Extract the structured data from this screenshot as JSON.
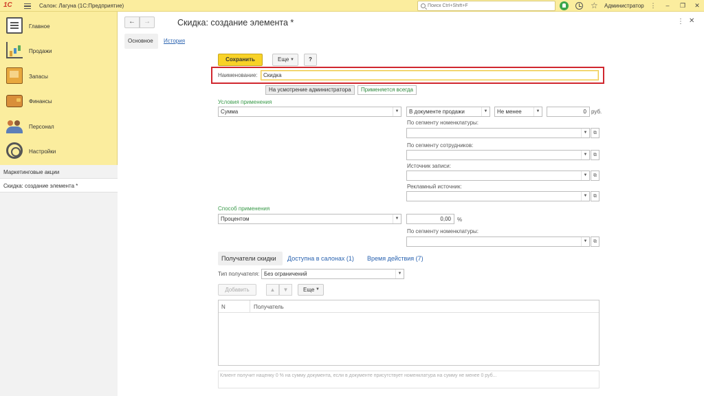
{
  "topbar": {
    "logo": "1С",
    "title": "Салон: Лагуна  (1С:Предприятие)",
    "search_placeholder": "Поиск Ctrl+Shift+F",
    "user": "Администратор"
  },
  "sidebar": {
    "items": [
      {
        "label": "Главное",
        "icon": "clipboard-icon"
      },
      {
        "label": "Продажи",
        "icon": "sales-chart-icon"
      },
      {
        "label": "Запасы",
        "icon": "stock-icon"
      },
      {
        "label": "Финансы",
        "icon": "wallet-icon"
      },
      {
        "label": "Персонал",
        "icon": "people-icon"
      },
      {
        "label": "Настройки",
        "icon": "gear-icon"
      }
    ],
    "panel_header": "Маркетинговые акции",
    "open_window": "Скидка: создание элемента *"
  },
  "form": {
    "title": "Скидка: создание элемента *",
    "tabs": {
      "main": "Основное",
      "history": "История"
    },
    "toolbar": {
      "save": "Сохранить",
      "more": "Еще",
      "help": "?"
    },
    "name_label": "Наименование:",
    "name_value": "Скидка",
    "mode_buttons": {
      "admin": "На усмотрение администратора",
      "always": "Применяется всегда"
    },
    "conditions": {
      "title": "Условия применения",
      "type_value": "Сумма",
      "doc_value": "В документе продажи",
      "compare_value": "Не менее",
      "amount_value": "0",
      "currency": "руб.",
      "segment_nom_label": "По сегменту номенклатуры:",
      "segment_staff_label": "По сегменту сотрудников:",
      "source_label": "Источник записи:",
      "ad_source_label": "Рекламный источник:"
    },
    "method": {
      "title": "Способ применения",
      "type_value": "Процентом",
      "value": "0,00",
      "unit": "%",
      "segment_nom_label": "По сегменту номенклатуры:"
    },
    "bottom_tabs": {
      "recipients": "Получатели скидки",
      "salons": "Доступна в салонах (1)",
      "time": "Время действия (7)"
    },
    "recipient_type_label": "Тип получателя:",
    "recipient_type_value": "Без ограничений",
    "table_toolbar": {
      "add": "Добавить",
      "more": "Еще"
    },
    "table_columns": {
      "n": "N",
      "recipient": "Получатель"
    },
    "comment": "Клиент получит наценку 0 % на сумму документа, если в документе присутствует номенклатура на сумму не менее 0 руб..."
  }
}
